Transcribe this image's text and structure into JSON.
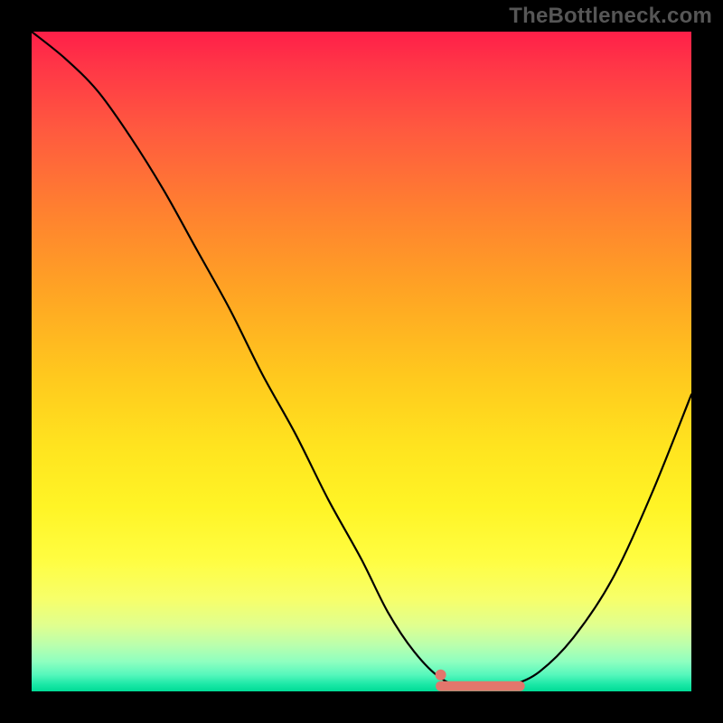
{
  "watermark": "TheBottleneck.com",
  "colors": {
    "background": "#000000",
    "gradient_top": "#ff1f48",
    "gradient_bottom": "#00db96",
    "curve": "#000000",
    "highlight": "#e2766c"
  },
  "chart_data": {
    "type": "line",
    "title": "",
    "xlabel": "",
    "ylabel": "",
    "xlim": [
      0,
      100
    ],
    "ylim": [
      0,
      100
    ],
    "series": [
      {
        "name": "bottleneck-curve",
        "x": [
          0,
          5,
          10,
          15,
          20,
          25,
          30,
          35,
          40,
          45,
          50,
          54,
          58,
          62,
          66,
          70,
          73,
          77,
          82,
          88,
          94,
          100
        ],
        "y": [
          100,
          96,
          91,
          84,
          76,
          67,
          58,
          48,
          39,
          29,
          20,
          12,
          6,
          2,
          0.5,
          0.5,
          1,
          3,
          8,
          17,
          30,
          45
        ]
      }
    ],
    "highlight": {
      "name": "optimal-range",
      "dot": {
        "x": 62,
        "y": 2.5
      },
      "bar": {
        "x_start": 62,
        "x_end": 74,
        "y": 0.8
      }
    },
    "gradient_stops": [
      {
        "pos": 0.0,
        "color": "#ff1f48"
      },
      {
        "pos": 0.25,
        "color": "#ff8030"
      },
      {
        "pos": 0.55,
        "color": "#ffd51f"
      },
      {
        "pos": 0.8,
        "color": "#fffd41"
      },
      {
        "pos": 0.93,
        "color": "#baffad"
      },
      {
        "pos": 1.0,
        "color": "#00db96"
      }
    ]
  }
}
